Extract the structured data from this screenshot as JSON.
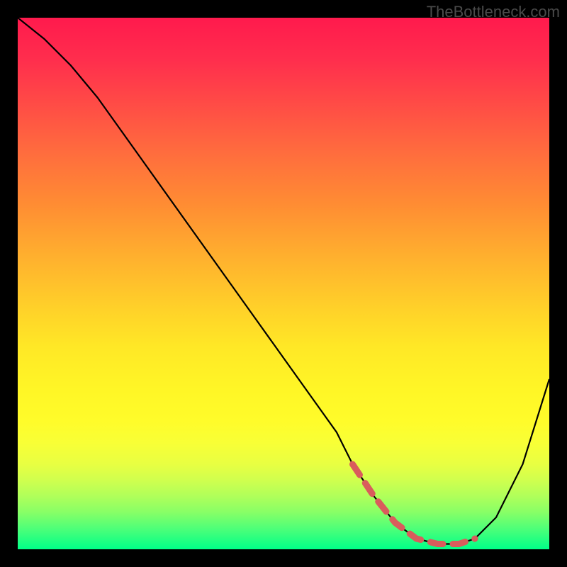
{
  "watermark": "TheBottleneck.com",
  "chart_data": {
    "type": "line",
    "title": "",
    "xlabel": "",
    "ylabel": "",
    "xlim": [
      0,
      100
    ],
    "ylim": [
      0,
      100
    ],
    "series": [
      {
        "name": "curve",
        "x": [
          0,
          5,
          10,
          15,
          20,
          25,
          30,
          35,
          40,
          45,
          50,
          55,
          60,
          63,
          67,
          71,
          75,
          79,
          83,
          86,
          90,
          95,
          100
        ],
        "values": [
          100,
          96,
          91,
          85,
          78,
          71,
          64,
          57,
          50,
          43,
          36,
          29,
          22,
          16,
          10,
          5,
          2,
          1,
          1,
          2,
          6,
          16,
          32
        ]
      }
    ],
    "highlight_range_x": [
      63,
      86
    ],
    "gradient_stops": [
      {
        "pos": 0,
        "color": "#ff1a4d"
      },
      {
        "pos": 50,
        "color": "#ffd229"
      },
      {
        "pos": 80,
        "color": "#f8ff36"
      },
      {
        "pos": 100,
        "color": "#00ff88"
      }
    ]
  }
}
